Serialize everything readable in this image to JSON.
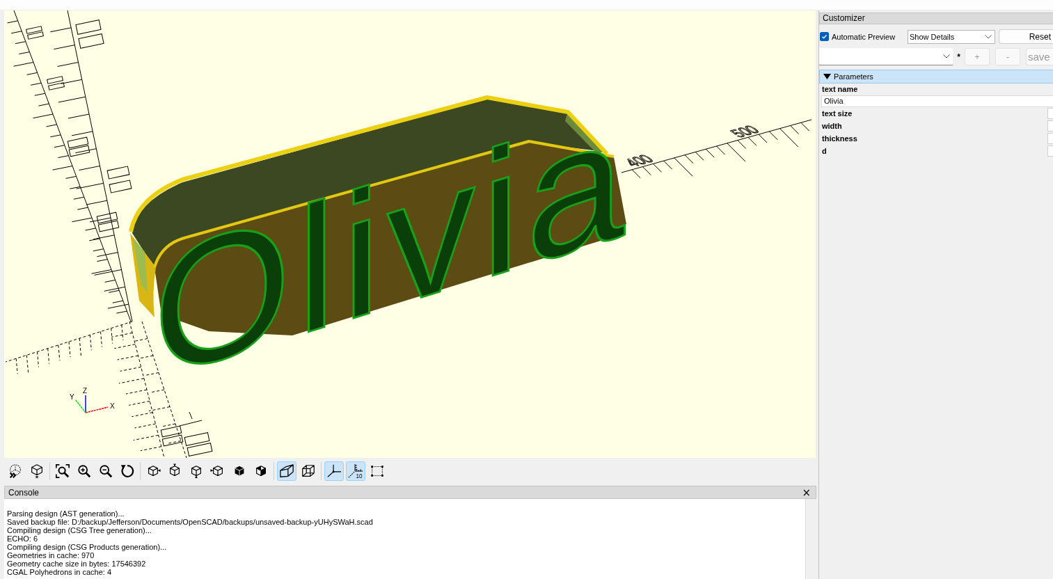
{
  "viewport": {
    "model_text": "Olivia",
    "ruler_labels": [
      "400",
      "500"
    ],
    "axis_labels": {
      "x": "X",
      "y": "Y",
      "z": "Z"
    }
  },
  "toolbar": {
    "groups": [
      [
        {
          "kind": "preview",
          "active": false
        },
        {
          "kind": "render",
          "active": false
        }
      ],
      [
        {
          "kind": "zoom_all",
          "active": false
        },
        {
          "kind": "zoom_in",
          "active": false
        },
        {
          "kind": "zoom_out",
          "active": false
        },
        {
          "kind": "reset_view",
          "active": false
        }
      ],
      [
        {
          "kind": "view_right",
          "active": false
        },
        {
          "kind": "view_top",
          "active": false
        },
        {
          "kind": "view_bottom",
          "active": false
        },
        {
          "kind": "view_left",
          "active": false
        },
        {
          "kind": "view_front",
          "active": false
        },
        {
          "kind": "view_back",
          "active": false
        }
      ],
      [
        {
          "kind": "perspective",
          "active": true
        },
        {
          "kind": "orthogonal",
          "active": false
        }
      ],
      [
        {
          "kind": "axes",
          "active": true
        },
        {
          "kind": "scale_markers",
          "active": true,
          "icon_text": "10"
        },
        {
          "kind": "edges",
          "active": false
        }
      ]
    ]
  },
  "console": {
    "title": "Console",
    "close": "×",
    "lines": [
      "Parsing design (AST generation)...",
      "Saved backup file: D:/backup/Jefferson/Documents/OpenSCAD/backups/unsaved-backup-yUHySWaH.scad",
      "Compiling design (CSG Tree generation)...",
      "ECHO: 6",
      "Compiling design (CSG Products generation)...",
      "Geometries in cache: 970",
      "Geometry cache size in bytes: 17546392",
      "CGAL Polyhedrons in cache: 4"
    ]
  },
  "customizer": {
    "title": "Customizer",
    "auto_preview": {
      "label": "Automatic Preview",
      "checked": true
    },
    "detail_select": {
      "value": "Show Details"
    },
    "reset_button": {
      "label": "Reset",
      "disabled": false
    },
    "preset": {
      "modified_mark": "*",
      "buttons": [
        {
          "label": "+",
          "disabled": true
        },
        {
          "label": "-",
          "disabled": true
        },
        {
          "label": "save",
          "disabled": true
        }
      ]
    },
    "groups": [
      {
        "title": "Parameters",
        "expanded": true,
        "params": [
          {
            "label": "text name",
            "kind": "text",
            "value": "Olivia"
          },
          {
            "label": "text size",
            "kind": "number"
          },
          {
            "label": "width",
            "kind": "number"
          },
          {
            "label": "thickness",
            "kind": "number"
          },
          {
            "label": "d",
            "kind": "number"
          }
        ]
      }
    ]
  }
}
